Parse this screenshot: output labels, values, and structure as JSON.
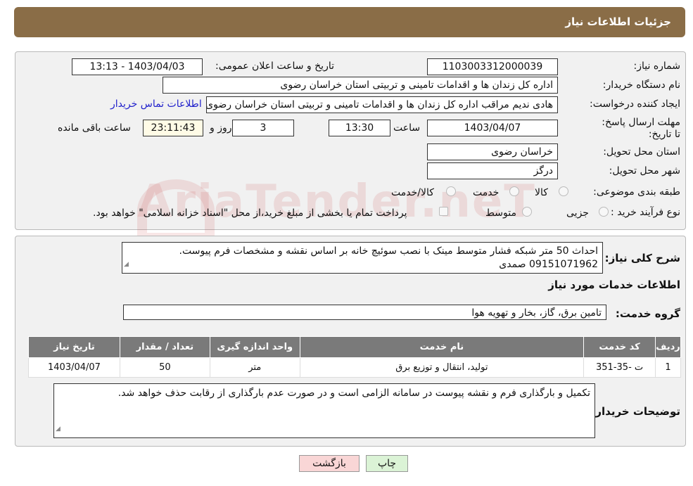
{
  "title": "جزئیات اطلاعات نیاز",
  "watermark": "AriaTender.neT",
  "fields": {
    "need_number_label": "شماره نیاز:",
    "need_number": "1103003312000039",
    "announce_label": "تاریخ و ساعت اعلان عمومی:",
    "announce_value": "1403/04/03 - 13:13",
    "buyer_org_label": "نام دستگاه خریدار:",
    "buyer_org": "اداره کل زندان ها و اقدامات تامینی و تربیتی استان خراسان رضوی",
    "creator_label": "ایجاد کننده درخواست:",
    "creator": "هادی ندیم مراقب اداره کل زندان ها و اقدامات تامینی و تربیتی استان خراسان رضوی",
    "contact_link": "اطلاعات تماس خریدار",
    "deadline_label": "مهلت ارسال پاسخ: تا تاریخ:",
    "deadline_date": "1403/04/07",
    "time_label": "ساعت",
    "deadline_time": "13:30",
    "days_value": "3",
    "days_label": "روز و",
    "remaining_time": "23:11:43",
    "remaining_label": "ساعت باقی مانده",
    "province_label": "استان محل تحویل:",
    "province": "خراسان رضوی",
    "city_label": "شهر محل تحویل:",
    "city": "درگز",
    "category_label": "طبقه بندی موضوعی:",
    "category_options": [
      "کالا",
      "خدمت",
      "کالا/خدمت"
    ],
    "process_label": "نوع فرآیند خرید :",
    "process_options": [
      "جزیی",
      "متوسط"
    ],
    "payment_note": "پرداخت تمام یا بخشی از مبلغ خرید،از محل \"اسناد خزانه اسلامی\" خواهد بود."
  },
  "summary": {
    "label": "شرح کلی نیاز:",
    "text_line1": "احداث 50 متر شبکه فشار متوسط مینک با نصب سوئیچ خانه بر اساس نقشه و مشخصات فرم پیوست.",
    "text_line2": "09151071962 صمدی"
  },
  "services": {
    "heading": "اطلاعات خدمات مورد نیاز",
    "group_label": "گروه خدمت:",
    "group_value": "تامین برق، گاز، بخار و تهویه هوا",
    "columns": [
      "ردیف",
      "کد خدمت",
      "نام خدمت",
      "واحد اندازه گیری",
      "تعداد / مقدار",
      "تاریخ نیاز"
    ],
    "rows": [
      [
        "1",
        "ت -35-351",
        "تولید، انتقال و توزیع برق",
        "متر",
        "50",
        "1403/04/07"
      ]
    ]
  },
  "buyer_notes": {
    "label": "توضیحات خریدار:",
    "text": "تکمیل و بارگذاری فرم و نقشه پیوست در سامانه الزامی است و در صورت عدم بارگذاری از رقابت حذف خواهد شد."
  },
  "buttons": {
    "print": "چاپ",
    "back": "بازگشت"
  },
  "colors": {
    "header": "#8a6d47",
    "table_header": "#7a7a7a",
    "link": "#2222cc",
    "back_button": "#f9d6d6",
    "print_button": "#dbf3d6"
  }
}
